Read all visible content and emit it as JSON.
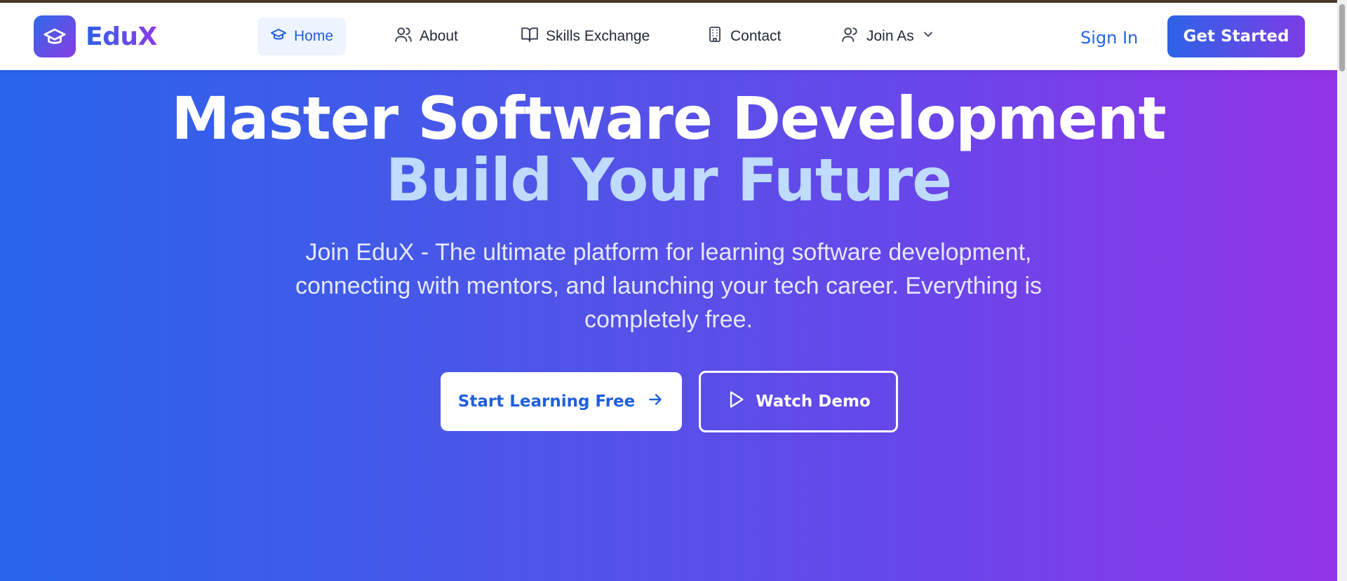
{
  "brand": {
    "name": "EduX",
    "logo_icon": "graduation-cap-icon"
  },
  "nav": {
    "items": [
      {
        "label": "Home",
        "icon": "graduation-cap-icon",
        "active": true
      },
      {
        "label": "About",
        "icon": "users-icon",
        "active": false
      },
      {
        "label": "Skills Exchange",
        "icon": "book-open-icon",
        "active": false
      },
      {
        "label": "Contact",
        "icon": "building-icon",
        "active": false
      },
      {
        "label": "Join As",
        "icon": "user-icon",
        "active": false,
        "dropdown": true
      }
    ],
    "sign_in": "Sign In",
    "get_started": "Get Started"
  },
  "hero": {
    "title_line1": "Master Software Development",
    "title_line2": "Build Your Future",
    "subtitle": "Join EduX - The ultimate platform for learning software development, connecting with mentors, and launching your tech career. Everything is completely free.",
    "primary_cta": "Start Learning Free",
    "secondary_cta": "Watch Demo"
  },
  "colors": {
    "accent": "#2563eb",
    "gradient_start": "#2864ec",
    "gradient_end": "#9234e6",
    "title_highlight": "#bfdbfe"
  }
}
